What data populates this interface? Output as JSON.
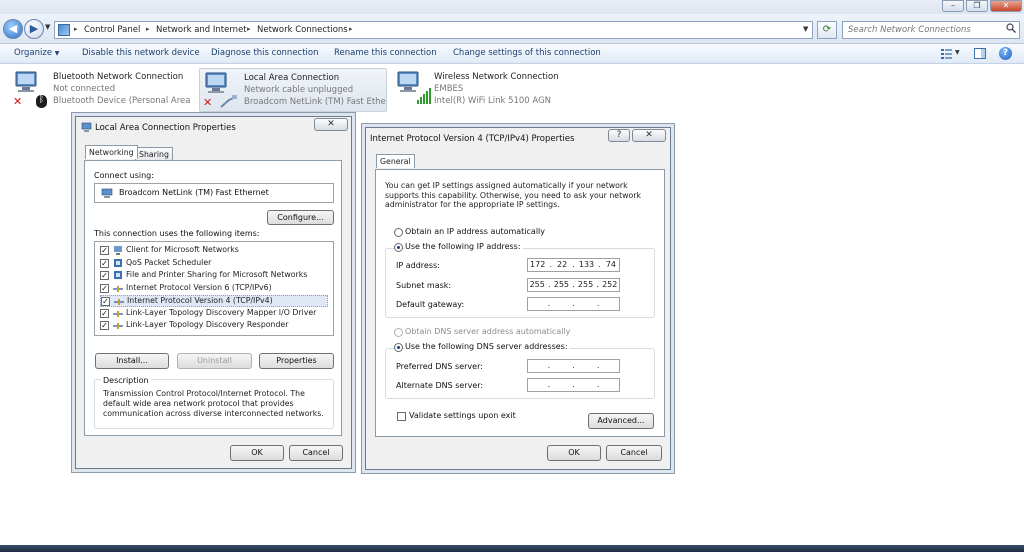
{
  "address_bar": {
    "breadcrumbs": [
      "Control Panel",
      "Network and Internet",
      "Network Connections"
    ],
    "search_placeholder": "Search Network Connections"
  },
  "command_bar": {
    "items": [
      "Organize",
      "Disable this network device",
      "Diagnose this connection",
      "Rename this connection",
      "Change settings of this connection"
    ]
  },
  "connections": [
    {
      "name": "Bluetooth Network Connection",
      "status": "Not connected",
      "device": "Bluetooth Device (Personal Area ..."
    },
    {
      "name": "Local Area Connection",
      "status": "Network cable unplugged",
      "device": "Broadcom NetLink (TM) Fast Ethe..."
    },
    {
      "name": "Wireless Network Connection",
      "status": "EMBES",
      "device": "Intel(R) WiFi Link 5100 AGN"
    }
  ],
  "lac_dialog": {
    "title": "Local Area Connection Properties",
    "tabs": [
      "Networking",
      "Sharing"
    ],
    "connect_using_label": "Connect using:",
    "adapter": "Broadcom NetLink (TM) Fast Ethernet",
    "configure_label": "Configure...",
    "items_label": "This connection uses the following items:",
    "items": [
      {
        "label": "Client for Microsoft Networks",
        "checked": true
      },
      {
        "label": "QoS Packet Scheduler",
        "checked": true
      },
      {
        "label": "File and Printer Sharing for Microsoft Networks",
        "checked": true
      },
      {
        "label": "Internet Protocol Version 6 (TCP/IPv6)",
        "checked": true
      },
      {
        "label": "Internet Protocol Version 4 (TCP/IPv4)",
        "checked": true
      },
      {
        "label": "Link-Layer Topology Discovery Mapper I/O Driver",
        "checked": true
      },
      {
        "label": "Link-Layer Topology Discovery Responder",
        "checked": true
      }
    ],
    "install_label": "Install...",
    "uninstall_label": "Uninstall",
    "properties_label": "Properties",
    "description_label": "Description",
    "description_text": "Transmission Control Protocol/Internet Protocol. The default wide area network protocol that provides communication across diverse interconnected networks.",
    "ok_label": "OK",
    "cancel_label": "Cancel"
  },
  "ipv4_dialog": {
    "title": "Internet Protocol Version 4 (TCP/IPv4) Properties",
    "help_glyph": "?",
    "tab": "General",
    "intro": "You can get IP settings assigned automatically if your network supports this capability. Otherwise, you need to ask your network administrator for the appropriate IP settings.",
    "obtain_ip_auto": "Obtain an IP address automatically",
    "use_following_ip": "Use the following IP address:",
    "ip_address_label": "IP address:",
    "ip_address": [
      "172",
      "22",
      "133",
      "74"
    ],
    "subnet_mask_label": "Subnet mask:",
    "subnet_mask": [
      "255",
      "255",
      "255",
      "252"
    ],
    "default_gateway_label": "Default gateway:",
    "obtain_dns_auto": "Obtain DNS server address automatically",
    "use_following_dns": "Use the following DNS server addresses:",
    "preferred_dns_label": "Preferred DNS server:",
    "alternate_dns_label": "Alternate DNS server:",
    "validate_label": "Validate settings upon exit",
    "advanced_label": "Advanced...",
    "ok_label": "OK",
    "cancel_label": "Cancel"
  }
}
